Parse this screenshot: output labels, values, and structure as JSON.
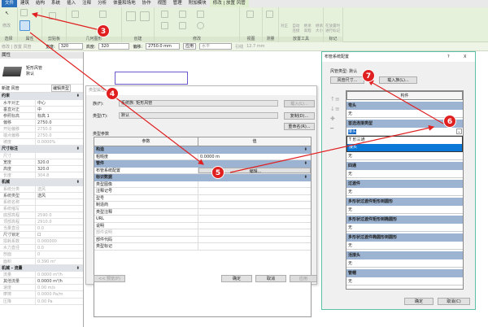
{
  "ribbon": {
    "tabs": [
      "文件",
      "建筑",
      "结构",
      "系统",
      "插入",
      "注释",
      "分析",
      "体量和场地",
      "协作",
      "视图",
      "管理",
      "附加模块",
      "修改 | 放置 风管"
    ],
    "panels": [
      "选择",
      "属性",
      "剪贴板",
      "几何图形",
      "创建",
      "修改",
      "视图",
      "测量",
      "放置工具",
      "标记"
    ],
    "labels": {
      "modify": "修改",
      "properties": "属性",
      "align": "对正",
      "auto_connect": "自动连接",
      "inherit_elev": "继承高程",
      "inherit_size": "继承大小",
      "tag_on_place": "在放置时进行标记"
    }
  },
  "options_bar": {
    "context": "修改 | 放置 风管",
    "width_label": "宽度:",
    "width_value": "320",
    "height_label": "高度:",
    "height_value": "320",
    "offset_label": "偏移:",
    "offset_value": "2750.0 mm",
    "apply": "应用",
    "horizontal": "水平",
    "leader": "引线",
    "size": "12.7 mm"
  },
  "properties": {
    "title": "属性",
    "family": "矩形风管",
    "type": "默认",
    "new_label": "新建 风管",
    "edit_type": "编辑类型",
    "groups": [
      {
        "name": "约束",
        "rows": [
          [
            "水平对正",
            "中心"
          ],
          [
            "垂直对正",
            "中"
          ],
          [
            "参照标高",
            "标高 1"
          ],
          [
            "偏移",
            "2750.0"
          ],
          [
            "开始偏移",
            "2750.0"
          ],
          [
            "端点偏移",
            "2750.0"
          ],
          [
            "坡度",
            "0.0000%"
          ]
        ]
      },
      {
        "name": "尺寸标注",
        "rows": [
          [
            "尺寸",
            ""
          ],
          [
            "宽度",
            "320.0"
          ],
          [
            "高度",
            "320.0"
          ],
          [
            "长度",
            "304.8"
          ]
        ]
      },
      {
        "name": "机械",
        "rows": [
          [
            "系统分类",
            "送风"
          ],
          [
            "系统类型",
            "送风"
          ],
          [
            "系统名称",
            ""
          ],
          [
            "系统缩写",
            ""
          ],
          [
            "底部高程",
            "2590.0"
          ],
          [
            "顶部高程",
            "2910.0"
          ],
          [
            "当量直径",
            "0.0"
          ],
          [
            "尺寸锁定",
            "☐"
          ],
          [
            "损耗系数",
            "0.000000"
          ],
          [
            "水力直径",
            "0.0"
          ],
          [
            "剖面",
            "0"
          ],
          [
            "面积",
            "0.390 m²"
          ]
        ]
      },
      {
        "name": "机械 - 流量",
        "rows": [
          [
            "流量",
            "0.0000 m³/h"
          ],
          [
            "其他流量",
            "0.0000 m³/h"
          ],
          [
            "速度",
            "0.00 m/s"
          ],
          [
            "摩擦",
            "0.0000 Pa/m"
          ],
          [
            "压降",
            "0.00 Pa"
          ]
        ]
      }
    ]
  },
  "type_dialog": {
    "title": "类型属性",
    "family_label": "族(F):",
    "family_value": "系统族: 矩形风管",
    "type_label": "类型(T):",
    "type_value": "默认",
    "load": "载入(L)...",
    "duplicate": "复制(D)...",
    "rename": "重命名(R)...",
    "params_label": "类型参数",
    "col_param": "参数",
    "col_value": "值",
    "groups": [
      {
        "name": "构造",
        "rows": [
          [
            "粗糙度",
            "0.0000 m"
          ]
        ]
      },
      {
        "name": "管件",
        "rows": [
          [
            "布管系统配置",
            "编辑..."
          ]
        ]
      },
      {
        "name": "标识数据",
        "rows": [
          [
            "类型图像",
            ""
          ],
          [
            "注释记号",
            ""
          ],
          [
            "型号",
            ""
          ],
          [
            "制造商",
            ""
          ],
          [
            "类型注释",
            ""
          ],
          [
            "URL",
            ""
          ],
          [
            "说明",
            ""
          ],
          [
            "部件说明",
            ""
          ],
          [
            "部件代码",
            ""
          ],
          [
            "类型标记",
            ""
          ]
        ]
      }
    ],
    "preview": "<< 预览(P)",
    "ok": "确定",
    "cancel": "取消",
    "apply": "应用"
  },
  "routing_dialog": {
    "title": "布管系统配置",
    "help": "?",
    "close": "X",
    "duct_type": "风管类型: 默认",
    "sizes": "风管尺寸...",
    "load_family": "载入族(L)...",
    "col": "构件",
    "sections": [
      {
        "name": "弯头",
        "value": "无"
      },
      {
        "name": "首选连接类型",
        "value": "接头",
        "dropdown": [
          "T 形三通",
          "接头"
        ]
      },
      {
        "name": "",
        "value": "无"
      },
      {
        "name": "四通",
        "value": "无"
      },
      {
        "name": "过渡件",
        "value": "无"
      },
      {
        "name": "多形状过渡件矩形到圆形",
        "value": "无"
      },
      {
        "name": "多形状过渡件矩形到椭圆形",
        "value": "无"
      },
      {
        "name": "多形状过渡件椭圆形到圆形",
        "value": "无"
      },
      {
        "name": "活接头",
        "value": "无"
      },
      {
        "name": "管帽",
        "value": "无"
      }
    ],
    "ok": "确定",
    "cancel": "取消(C)"
  },
  "annotations": [
    "3",
    "4",
    "5",
    "6",
    "7"
  ],
  "colors": {
    "accent": "#e02020",
    "group": "#9cb4d2",
    "ribbon": "#e6f1dc"
  }
}
